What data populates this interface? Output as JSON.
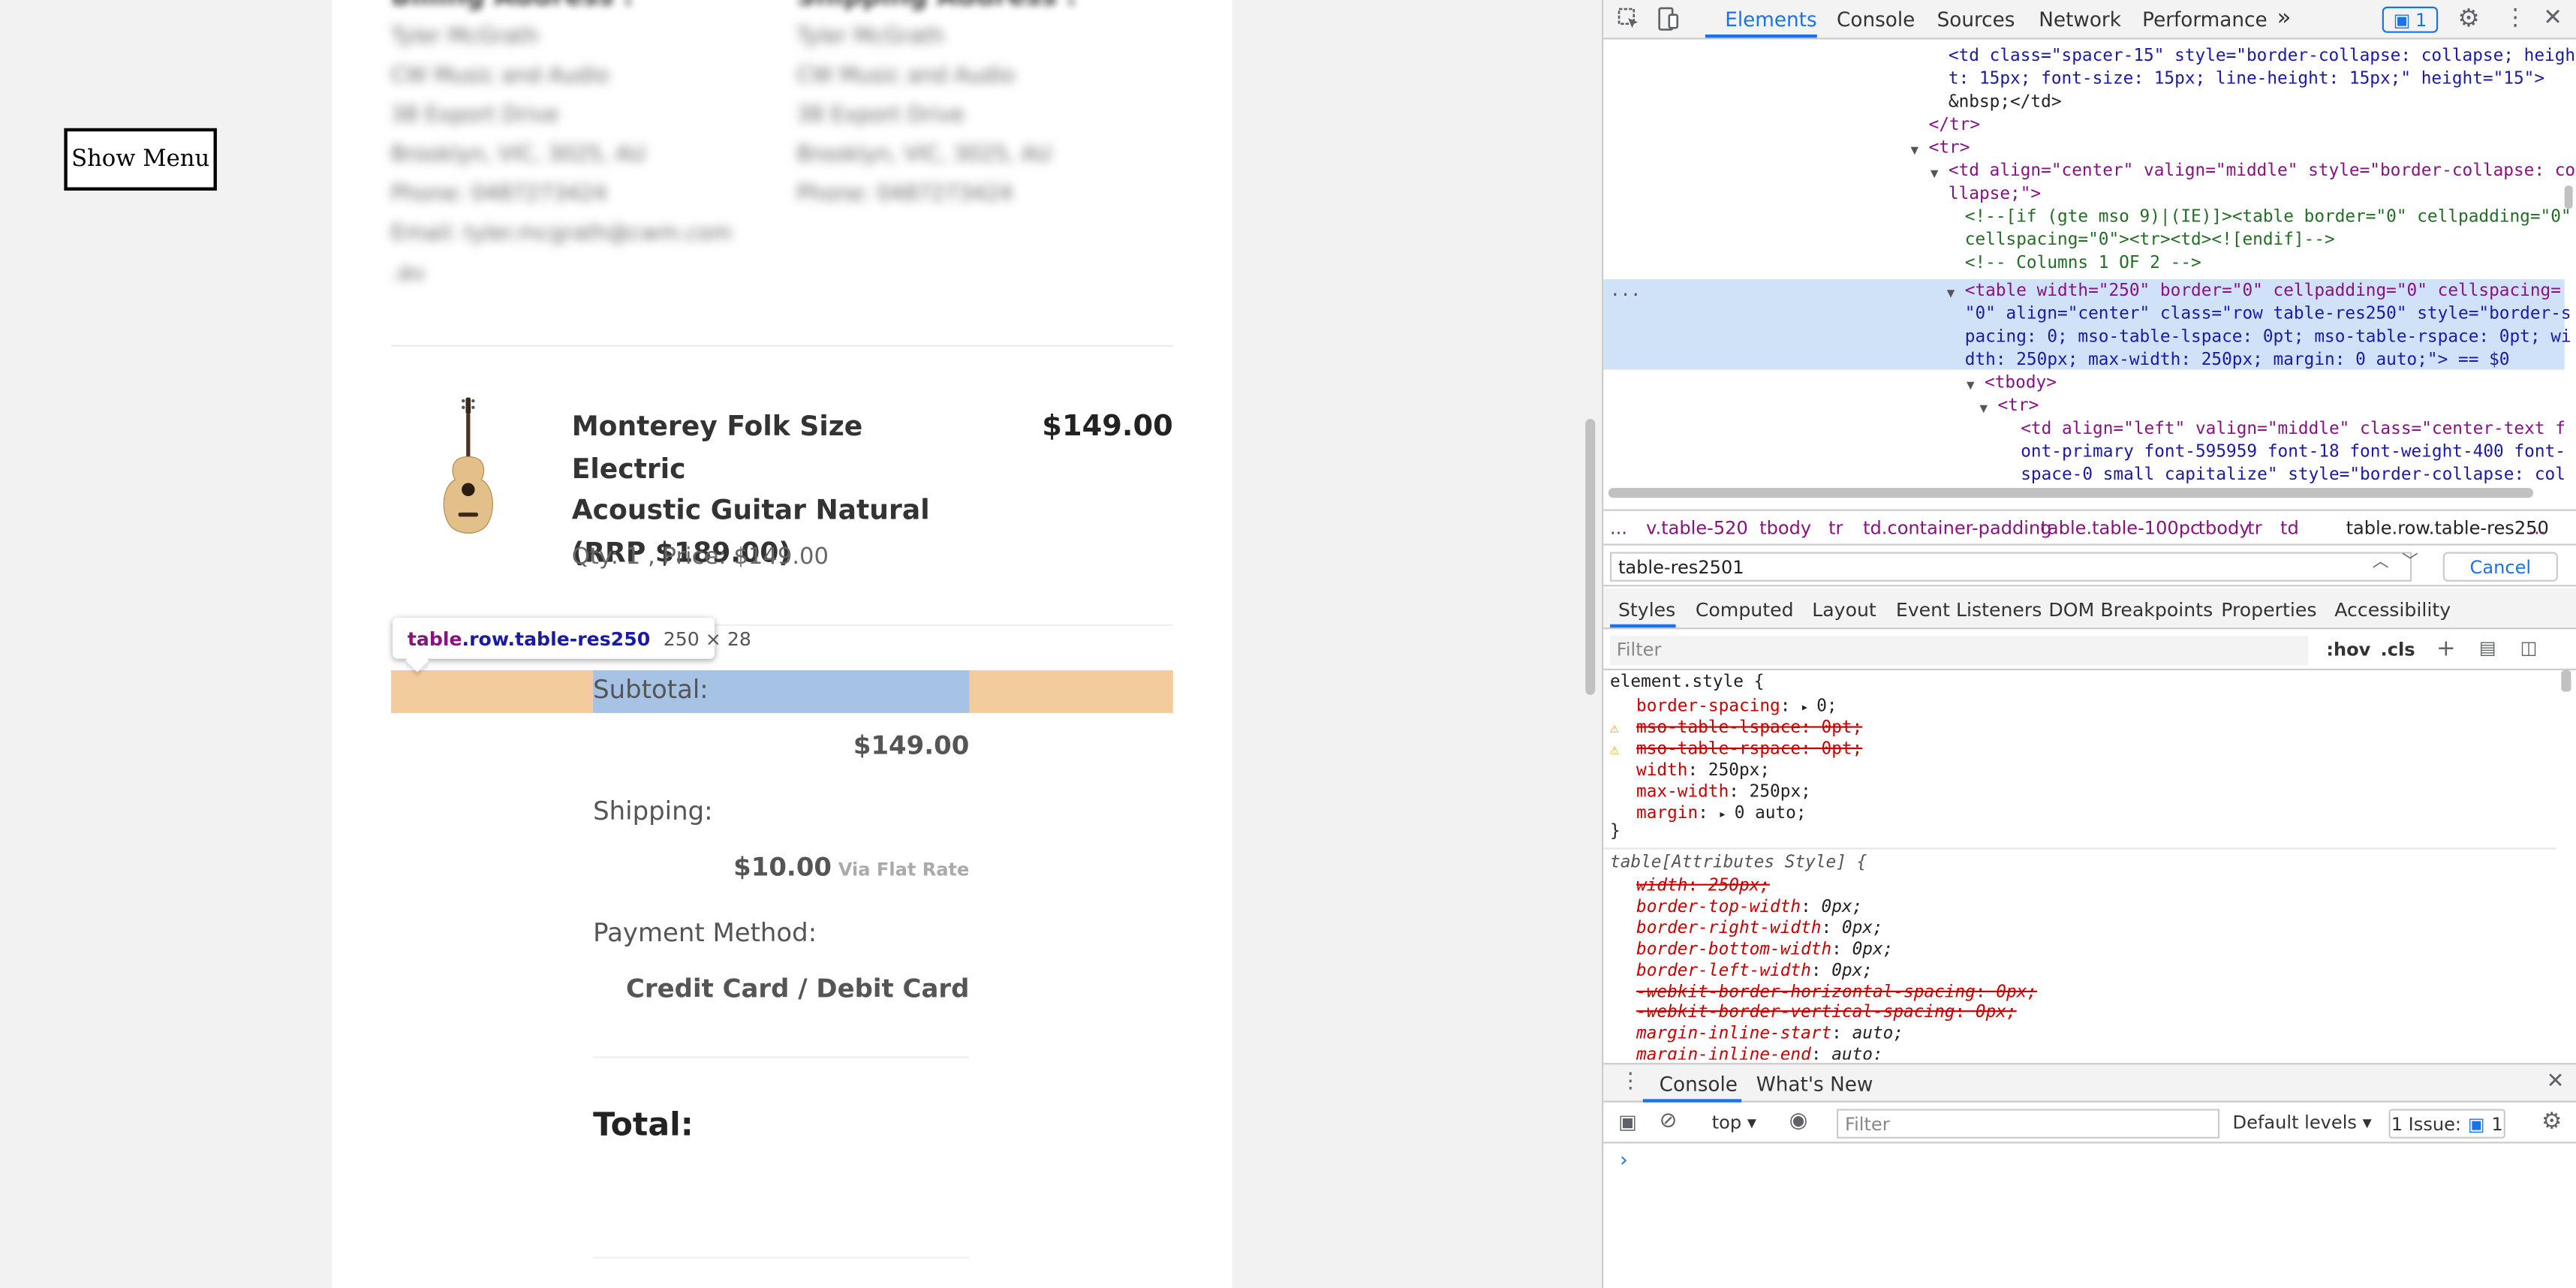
{
  "page": {
    "show_menu": "Show Menu",
    "billing_heading": "Billing Address :",
    "shipping_heading": "Shipping Address :",
    "billing_lines": [
      "Tyler McGrath",
      "CW Music and Audio",
      "38 Export Drive",
      "Brooklyn, VIC, 3025, AU",
      "Phone: 0487273424",
      "Email: tyler.mcgrath@cwm.com",
      ".au"
    ],
    "shipping_lines": [
      "Tyler McGrath",
      "CW Music and Audio",
      "38 Export Drive",
      "Brooklyn, VIC, 3025, AU",
      "Phone: 0487273424"
    ],
    "product": {
      "name_line1": "Monterey Folk Size Electric",
      "name_line2": "Acoustic Guitar Natural",
      "name_line3": "(RRP $189.00)",
      "price": "$149.00",
      "qty_text": "Qty: 1 , Price: $149.00"
    },
    "tooltip": {
      "tag": "table",
      "cls": ".row.table-res250",
      "size": "250 × 28"
    },
    "summary": {
      "subtotal_label": "Subtotal:",
      "subtotal_value": "$149.00",
      "shipping_label": "Shipping:",
      "shipping_value": "$10.00",
      "shipping_via": "Via Flat Rate",
      "payment_label": "Payment Method:",
      "payment_value": "Credit Card / Debit Card",
      "total_label": "Total:"
    }
  },
  "devtools": {
    "tabs": [
      "Elements",
      "Console",
      "Sources",
      "Network",
      "Performance"
    ],
    "more_tabs": "»",
    "issues_count": "1",
    "dom_lines": [
      "<td class=\"spacer-15\" style=\"border-collapse: collapse; heigh",
      "t: 15px; font-size: 15px; line-height: 15px;\" height=\"15\">",
      "&nbsp;</td>",
      "</tr>",
      "<tr>",
      "<td align=\"center\" valign=\"middle\" style=\"border-collapse: co",
      "llapse;\">",
      "<!--[if (gte mso 9)|(IE)]><table border=\"0\" cellpadding=\"0\"",
      "cellspacing=\"0\"><tr><td><![endif]-->",
      "<!-- Columns 1 OF 2 -->",
      "<table width=\"250\" border=\"0\" cellpadding=\"0\" cellspacing=",
      "\"0\" align=\"center\" class=\"row table-res250\" style=\"border-s",
      "pacing: 0; mso-table-lspace: 0pt; mso-table-rspace: 0pt; wi",
      "dth: 250px; max-width: 250px; margin: 0 auto;\"> == $0",
      "<tbody>",
      "<tr>",
      "<td align=\"left\" valign=\"middle\" class=\"center-text f",
      "ont-primary font-595959 font-18 font-weight-400 font-",
      "space-0 small capitalize\" style=\"border-collapse: col"
    ],
    "selected_marker": "...",
    "breadcrumbs": [
      "...",
      "v.table-520",
      "tbody",
      "tr",
      "td.container-padding",
      "table.table-100pc",
      "tbody",
      "tr",
      "td",
      "table.row.table-res250",
      "..."
    ],
    "search_value": "table-res2501",
    "cancel_label": "Cancel",
    "pane_tabs": [
      "Styles",
      "Computed",
      "Layout",
      "Event Listeners",
      "DOM Breakpoints",
      "Properties",
      "Accessibility"
    ],
    "filter_placeholder": "Filter",
    "hov_label": ":hov",
    "cls_label": ".cls",
    "element_style_selector": "element.style {",
    "element_style_rules": [
      {
        "prop": "border-spacing",
        "val": "0;",
        "struck": false,
        "warn": false,
        "arrow": true
      },
      {
        "prop": "mso-table-lspace",
        "val": "0pt;",
        "struck": true,
        "warn": true,
        "arrow": false
      },
      {
        "prop": "mso-table-rspace",
        "val": "0pt;",
        "struck": true,
        "warn": true,
        "arrow": false
      },
      {
        "prop": "width",
        "val": "250px;",
        "struck": false,
        "warn": false,
        "arrow": false
      },
      {
        "prop": "max-width",
        "val": "250px;",
        "struck": false,
        "warn": false,
        "arrow": false
      },
      {
        "prop": "margin",
        "val": "0 auto;",
        "struck": false,
        "warn": false,
        "arrow": true
      }
    ],
    "close_brace": "}",
    "attr_style_selector": "table[Attributes Style] {",
    "attr_style_rules": [
      {
        "prop": "width",
        "val": "250px;",
        "struck": true
      },
      {
        "prop": "border-top-width",
        "val": "0px;",
        "struck": false
      },
      {
        "prop": "border-right-width",
        "val": "0px;",
        "struck": false
      },
      {
        "prop": "border-bottom-width",
        "val": "0px;",
        "struck": false
      },
      {
        "prop": "border-left-width",
        "val": "0px;",
        "struck": false
      },
      {
        "prop": "-webkit-border-horizontal-spacing",
        "val": "0px;",
        "struck": true
      },
      {
        "prop": "-webkit-border-vertical-spacing",
        "val": "0px;",
        "struck": true
      },
      {
        "prop": "margin-inline-start",
        "val": "auto;",
        "struck": false
      },
      {
        "prop": "margin-inline-end",
        "val": "auto;",
        "struck": false
      }
    ],
    "drawer_tabs": [
      "Console",
      "What's New"
    ],
    "console_context": "top",
    "console_filter_placeholder": "Filter",
    "default_levels": "Default levels",
    "issue_badge": "1 Issue:",
    "issue_badge_count": "1",
    "prompt": "›"
  }
}
